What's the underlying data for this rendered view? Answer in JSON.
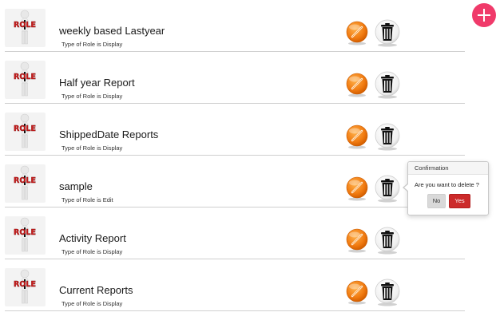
{
  "roles": [
    {
      "name": "weekly based Lastyear",
      "type_text": "Type of Role is Display",
      "thumbnail_label": "ROLE"
    },
    {
      "name": "Half year Report",
      "type_text": "Type of Role is Display",
      "thumbnail_label": "ROLE"
    },
    {
      "name": "ShippedDate Reports",
      "type_text": "Type of Role is Display",
      "thumbnail_label": "ROLE"
    },
    {
      "name": "sample",
      "type_text": "Type of Role is Edit",
      "thumbnail_label": "ROLE"
    },
    {
      "name": "Activity Report",
      "type_text": "Type of Role is Display",
      "thumbnail_label": "ROLE"
    },
    {
      "name": "Current Reports",
      "type_text": "Type of Role is Display",
      "thumbnail_label": "ROLE"
    }
  ],
  "icons": {
    "add": "plus-icon",
    "edit": "pencil-icon",
    "delete": "trash-icon"
  },
  "confirmation": {
    "title": "Confirmation",
    "message": "Are you want to delete ?",
    "no_label": "No",
    "yes_label": "Yes"
  },
  "colors": {
    "add_button": "#f03a6a",
    "edit_button": "#f07a10",
    "yes_button": "#cc2a2a",
    "no_button": "#d9d9d9"
  }
}
